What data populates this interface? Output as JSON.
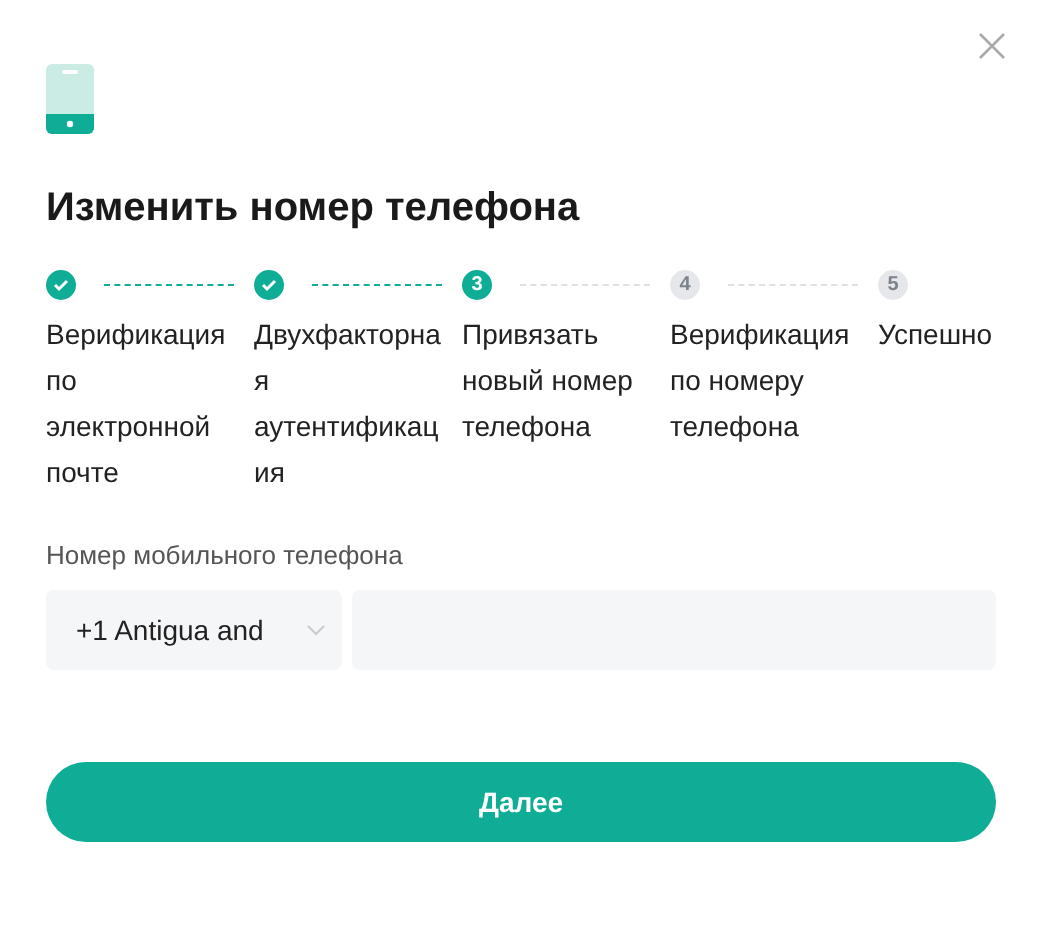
{
  "dialog": {
    "title": "Изменить номер телефона"
  },
  "steps": [
    {
      "label": "Верификация по электронной почте",
      "done": true,
      "active": false
    },
    {
      "label": "Двухфакторная аутентификация",
      "done": true,
      "active": false
    },
    {
      "number": "3",
      "label": "Привязать новый номер телефона",
      "done": false,
      "active": true
    },
    {
      "number": "4",
      "label": "Верификация по номеру телефона",
      "done": false,
      "active": false
    },
    {
      "number": "5",
      "label": "Успешно",
      "done": false,
      "active": false
    }
  ],
  "phone": {
    "label": "Номер мобильного телефона",
    "country": "+1 Antigua and"
  },
  "buttons": [
    "Далее"
  ]
}
